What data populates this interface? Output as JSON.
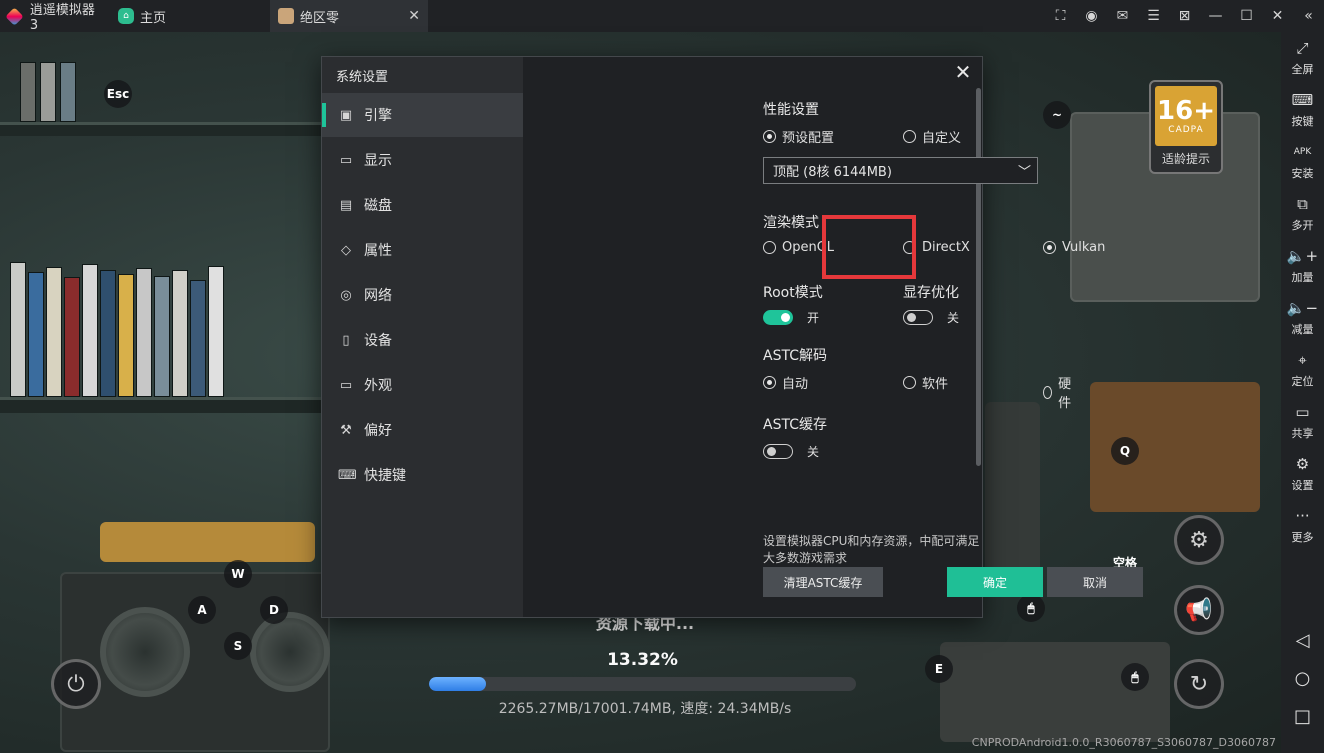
{
  "titlebar": {
    "app_name": "逍遥模拟器3",
    "home_tab": "主页",
    "game_tab": "绝区零",
    "close_glyph": "✕",
    "buttons": [
      "screenshot-icon",
      "user-icon",
      "mail-icon",
      "menu-icon",
      "feedback-icon",
      "minimize-icon",
      "maximize-icon",
      "close-icon",
      "collapse-icon"
    ]
  },
  "game": {
    "esc_key": "Esc",
    "tilde_key": "~",
    "q_key": "Q",
    "space_key": "空格",
    "w_key": "W",
    "a_key": "A",
    "s_key": "S",
    "d_key": "D",
    "e_key": "E",
    "age_rating": "16+",
    "age_org": "CADPA",
    "age_tip": "适龄提示",
    "download_title": "资源下载中...",
    "download_percent": "13.32%",
    "download_progress_fraction": 0.1332,
    "download_stats": "2265.27MB/17001.74MB, 速度: 24.34MB/s",
    "build_id": "CNPRODAndroid1.0.0_R3060787_S3060787_D3060787"
  },
  "sidebar": {
    "items": [
      {
        "label": "全屏",
        "icon": "fullscreen-icon",
        "glyph": "⤢"
      },
      {
        "label": "按键",
        "icon": "keyboard-icon",
        "glyph": "⌨"
      },
      {
        "label": "安装",
        "icon": "apk-icon",
        "glyph": "APK"
      },
      {
        "label": "多开",
        "icon": "multi-instance-icon",
        "glyph": "⧉"
      },
      {
        "label": "加量",
        "icon": "volume-up-icon",
        "glyph": "🔈+"
      },
      {
        "label": "减量",
        "icon": "volume-down-icon",
        "glyph": "🔈−"
      },
      {
        "label": "定位",
        "icon": "location-icon",
        "glyph": "⌖"
      },
      {
        "label": "共享",
        "icon": "folder-icon",
        "glyph": "▭"
      },
      {
        "label": "设置",
        "icon": "gear-icon",
        "glyph": "⚙"
      },
      {
        "label": "更多",
        "icon": "more-icon",
        "glyph": "···"
      }
    ]
  },
  "dialog": {
    "title": "系统设置",
    "close_glyph": "✕",
    "nav": [
      {
        "label": "引擎",
        "icon": "engine-icon",
        "glyph": "▣",
        "active": true
      },
      {
        "label": "显示",
        "icon": "display-icon",
        "glyph": "▭",
        "active": false
      },
      {
        "label": "磁盘",
        "icon": "disk-icon",
        "glyph": "▤",
        "active": false
      },
      {
        "label": "属性",
        "icon": "tag-icon",
        "glyph": "◇",
        "active": false
      },
      {
        "label": "网络",
        "icon": "globe-icon",
        "glyph": "◎",
        "active": false
      },
      {
        "label": "设备",
        "icon": "device-icon",
        "glyph": "▯",
        "active": false
      },
      {
        "label": "外观",
        "icon": "appearance-icon",
        "glyph": "▭",
        "active": false
      },
      {
        "label": "偏好",
        "icon": "wrench-icon",
        "glyph": "⚒",
        "active": false
      },
      {
        "label": "快捷键",
        "icon": "keyboard-icon",
        "glyph": "⌨",
        "active": false
      }
    ],
    "performance": {
      "title": "性能设置",
      "preset_label": "预设配置",
      "custom_label": "自定义",
      "selected": "preset",
      "dropdown_value": "顶配 (8核 6144MB)"
    },
    "render": {
      "title": "渲染模式",
      "options": [
        "OpenGL",
        "DirectX",
        "Vulkan"
      ],
      "selected": "Vulkan"
    },
    "root": {
      "title": "Root模式",
      "state_label": "开",
      "on": true
    },
    "vram": {
      "title": "显存优化",
      "state_label": "关",
      "on": false
    },
    "astc_decode": {
      "title": "ASTC解码",
      "options": [
        "自动",
        "软件",
        "硬件"
      ],
      "selected": "自动"
    },
    "astc_cache": {
      "title": "ASTC缓存",
      "state_label": "关",
      "on": false
    },
    "hint": "设置模拟器CPU和内存资源，中配可满足大多数游戏需求",
    "clear_cache_label": "清理ASTC缓存",
    "ok_label": "确定",
    "cancel_label": "取消"
  },
  "colors": {
    "accent": "#1fc49a",
    "highlight": "#e5383b",
    "dialog_bg": "#1f2124",
    "sidebar_bg": "#202225"
  }
}
